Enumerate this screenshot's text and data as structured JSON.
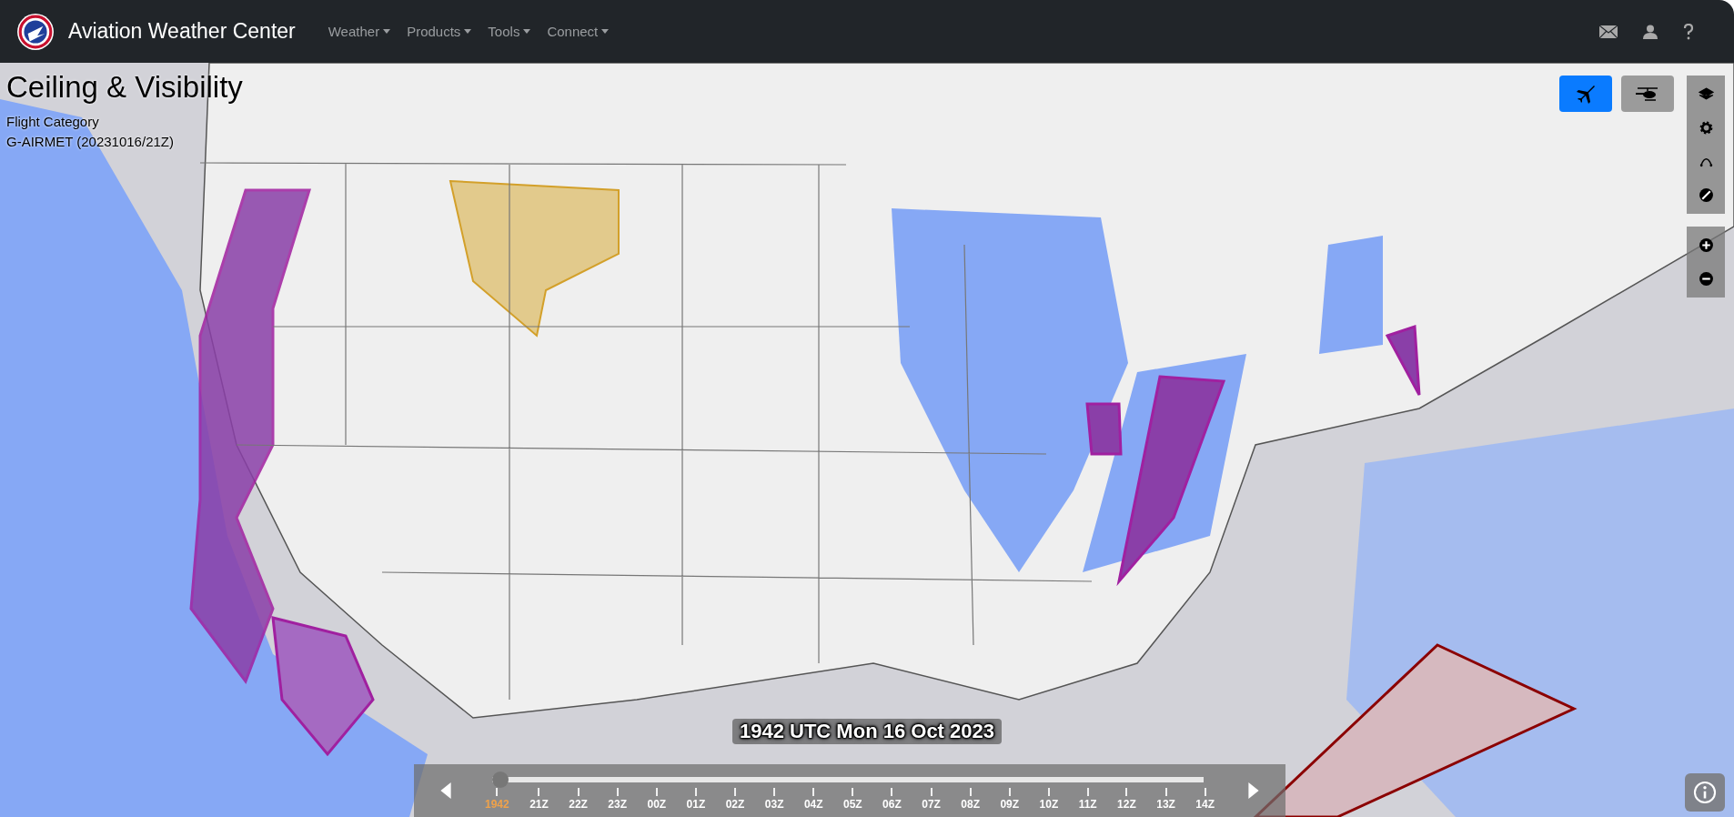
{
  "header": {
    "title": "Aviation Weather Center",
    "menus": [
      {
        "label": "Weather"
      },
      {
        "label": "Products"
      },
      {
        "label": "Tools"
      },
      {
        "label": "Connect"
      }
    ]
  },
  "panel": {
    "title": "Ceiling & Visibility",
    "subtitle": "Flight Category",
    "product": "G-AIRMET (20231016/21Z)"
  },
  "modes": [
    {
      "kind": "airplane",
      "selected": true
    },
    {
      "kind": "helicopter",
      "selected": false
    }
  ],
  "timeline": {
    "label": "1942 UTC Mon 16 Oct 2023",
    "level": 0,
    "ticks": [
      {
        "label": "1942",
        "selected": true
      },
      {
        "label": "21Z",
        "selected": false
      },
      {
        "label": "22Z",
        "selected": false
      },
      {
        "label": "23Z",
        "selected": false
      },
      {
        "label": "00Z",
        "selected": false
      },
      {
        "label": "01Z",
        "selected": false
      },
      {
        "label": "02Z",
        "selected": false
      },
      {
        "label": "03Z",
        "selected": false
      },
      {
        "label": "04Z",
        "selected": false
      },
      {
        "label": "05Z",
        "selected": false
      },
      {
        "label": "06Z",
        "selected": false
      },
      {
        "label": "07Z",
        "selected": false
      },
      {
        "label": "08Z",
        "selected": false
      },
      {
        "label": "09Z",
        "selected": false
      },
      {
        "label": "10Z",
        "selected": false
      },
      {
        "label": "11Z",
        "selected": false
      },
      {
        "label": "12Z",
        "selected": false
      },
      {
        "label": "13Z",
        "selected": false
      },
      {
        "label": "14Z",
        "selected": false
      }
    ]
  }
}
